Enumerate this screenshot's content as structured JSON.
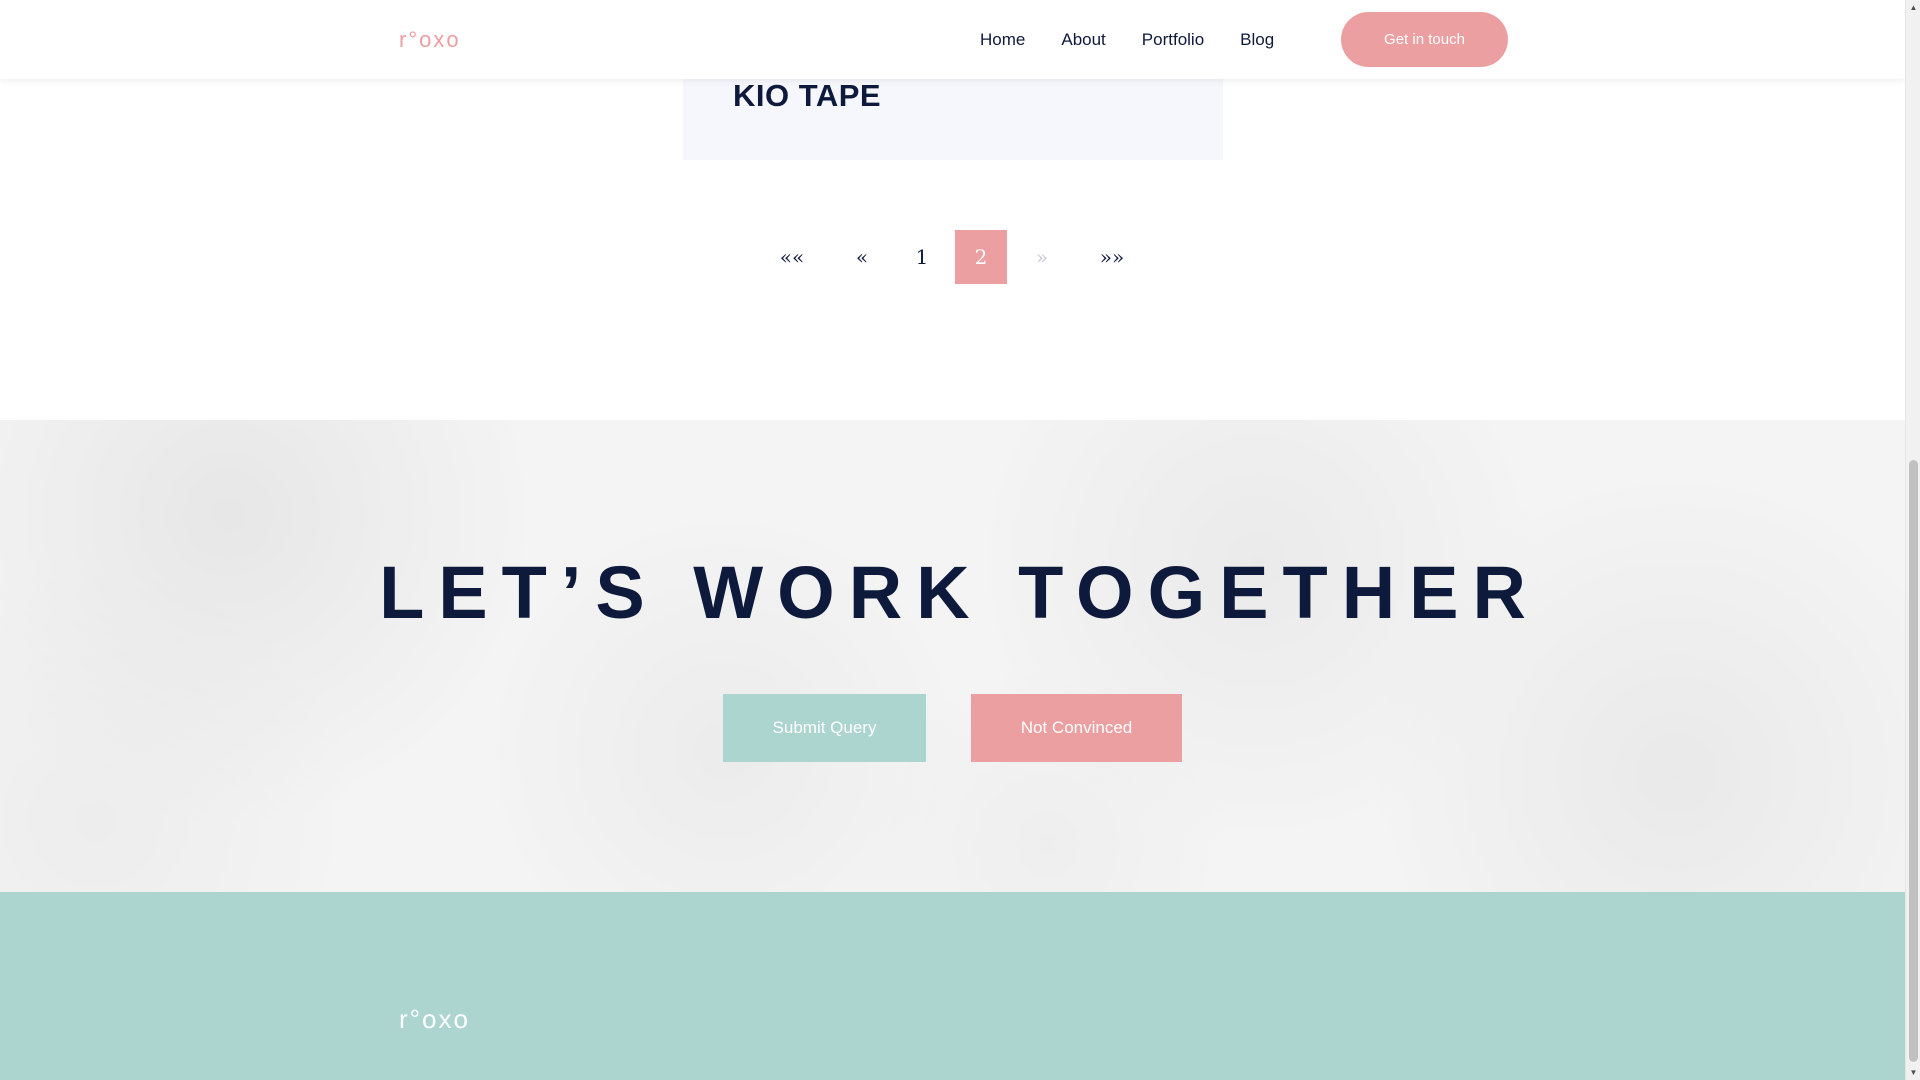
{
  "colors": {
    "accent_pink": "#ec9fa0",
    "accent_teal": "#acd5d0",
    "navy": "#0e1a3c"
  },
  "header": {
    "logo_text": "r°oxo",
    "nav": [
      {
        "label": "Home"
      },
      {
        "label": "About"
      },
      {
        "label": "Portfolio"
      },
      {
        "label": "Blog"
      }
    ],
    "cta_label": "Get in touch"
  },
  "portfolio_card": {
    "title": "KIO TAPE"
  },
  "pagination": {
    "first": "««",
    "prev": "«",
    "pages": [
      "1",
      "2"
    ],
    "current_page": "2",
    "next": "»",
    "last": "»»"
  },
  "cta_section": {
    "heading": "LET’S WORK TOGETHER",
    "submit_label": "Submit Query",
    "decline_label": "Not Convinced"
  },
  "footer": {
    "logo_text": "r°oxo"
  },
  "scrollbar": {
    "up_icon": "triangle-up-icon",
    "down_icon": "triangle-down-icon"
  }
}
